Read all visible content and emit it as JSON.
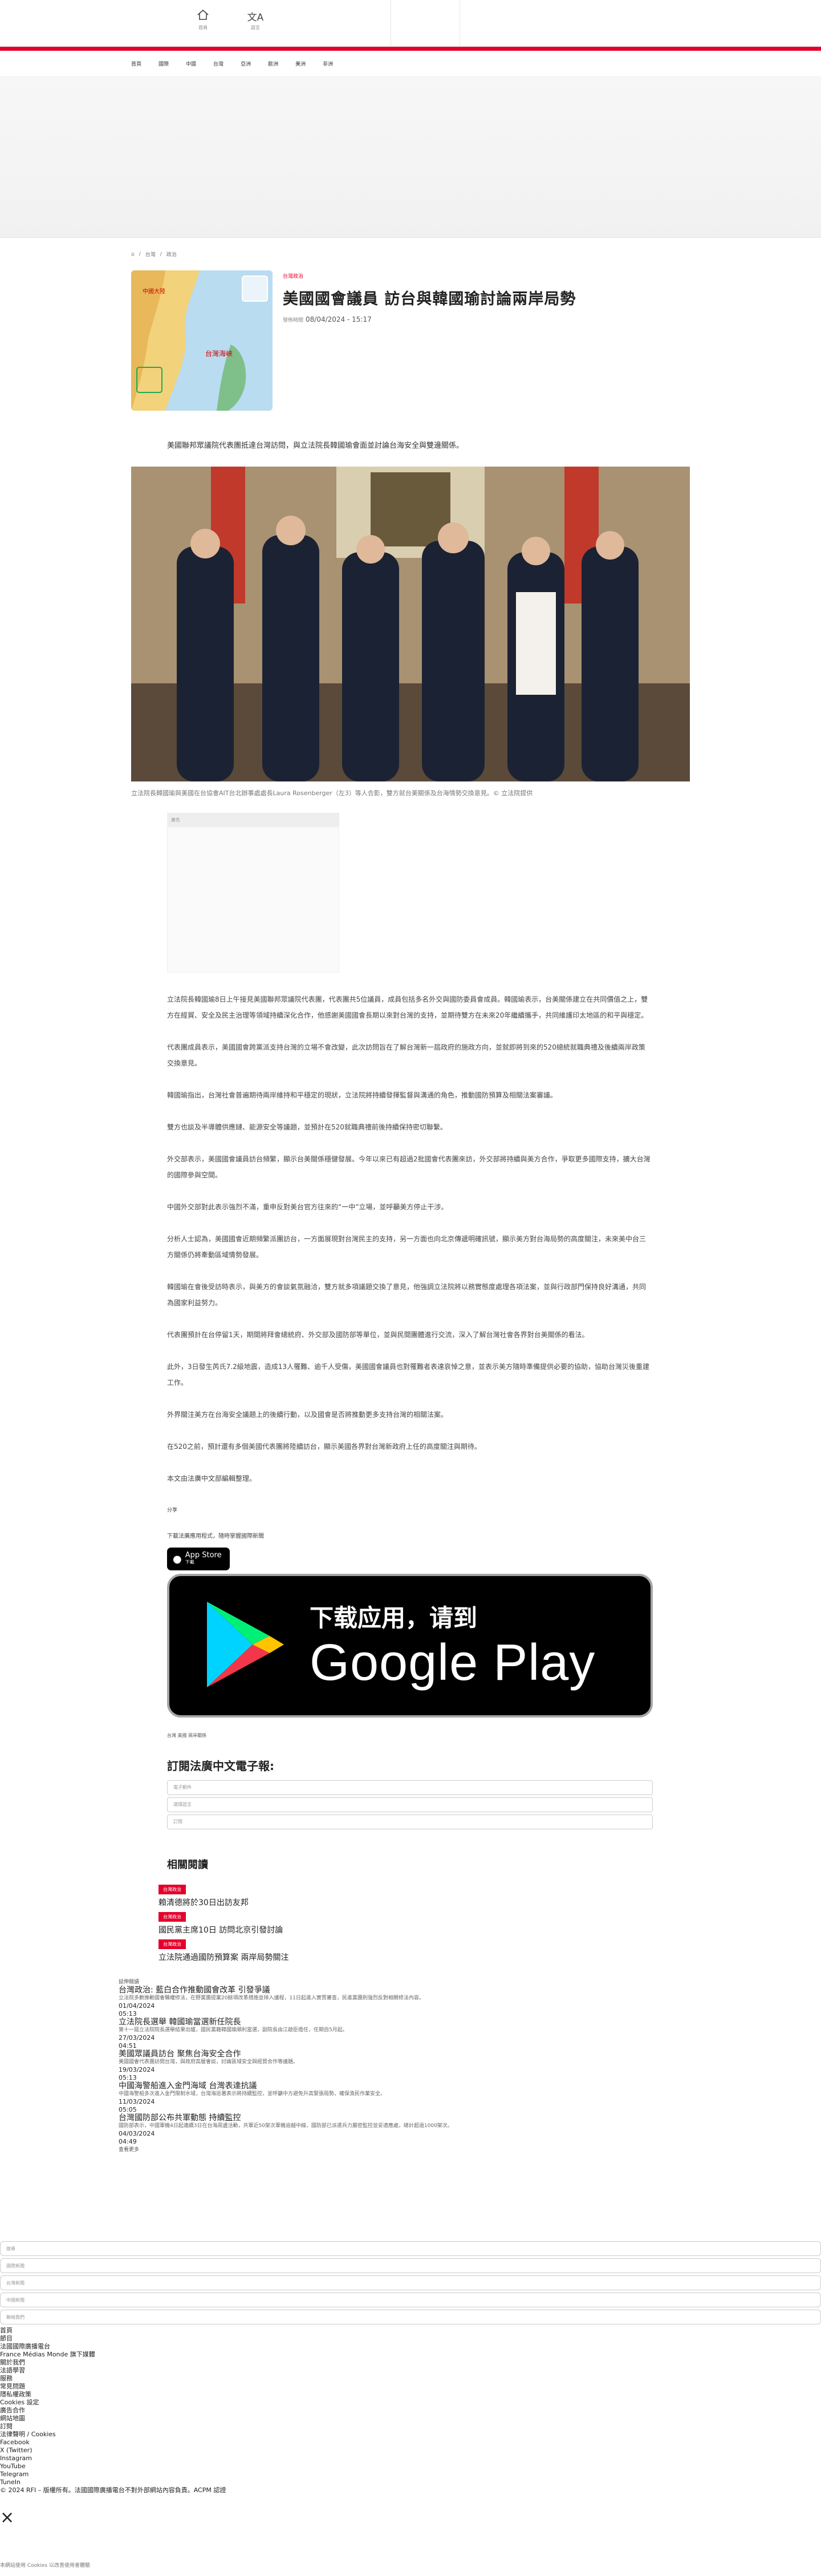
{
  "header": {
    "home_icon": "home-icon",
    "home_label": "首頁",
    "lang_icon": "translate-icon",
    "lang_label": "語言",
    "nav": [
      "首頁",
      "國際",
      "中國",
      "台灣",
      "亞洲",
      "歐洲",
      "美洲",
      "非洲"
    ]
  },
  "breadcrumb": {
    "items": [
      "首頁",
      "台灣",
      "政治"
    ]
  },
  "article": {
    "category": "台灣政治",
    "title": "美國國會議員 訪台與韓國瑜討論兩岸局勢",
    "date_label": "發佈時間",
    "date": "08/04/2024 - 15:17",
    "lead": "美國聯邦眾議院代表團抵達台灣訪問，與立法院長韓國瑜會面並討論台海安全與雙邊關係。",
    "caption": "立法院長韓國瑜與美國在台協會AIT台北辦事處處長Laura Rosenberger（左3）等人合影，雙方就台美關係及台海情勢交換意見。© 立法院提供"
  },
  "ad": {
    "label": "廣告"
  },
  "body": [
    "立法院長韓國瑜8日上午接見美國聯邦眾議院代表團，代表團共5位議員，成員包括多名外交與國防委員會成員。韓國瑜表示，台美關係建立在共同價值之上，雙方在經貿、安全及民主治理等領域持續深化合作，他感謝美國國會長期以來對台灣的支持，並期待雙方在未來20年繼續攜手，共同維護印太地區的和平與穩定。",
    "代表團成員表示，美國國會跨黨派支持台灣的立場不會改變，此次訪問旨在了解台灣新一屆政府的施政方向，並就即將到來的520總統就職典禮及後續兩岸政策交換意見。",
    "韓國瑜指出，台灣社會普遍期待兩岸維持和平穩定的現狀，立法院將持續發揮監督與溝通的角色，推動國防預算及相關法案審議。",
    "雙方也談及半導體供應鏈、能源安全等議題，並預計在520就職典禮前後持續保持密切聯繫。",
    "外交部表示，美國國會議員訪台頻繁，顯示台美關係穩健發展。今年以來已有超過2批國會代表團來訪，外交部將持續與美方合作，爭取更多國際支持，擴大台灣的國際參與空間。",
    "中國外交部對此表示強烈不滿，重申反對美台官方往來的“一中”立場，並呼籲美方停止干涉。",
    "分析人士認為，美國國會近期頻繁派團訪台，一方面展現對台灣民主的支持，另一方面也向北京傳遞明確訊號，顯示美方對台海局勢的高度關注，未來美中台三方關係仍將牽動區域情勢發展。",
    "韓國瑜在會後受訪時表示，與美方的會談氣氛融洽，雙方就多項議題交換了意見，他強調立法院將以務實態度處理各項法案，並與行政部門保持良好溝通，共同為國家利益努力。",
    "代表團預計在台停留1天，期間將拜會總統府、外交部及國防部等單位，並與民間團體進行交流，深入了解台灣社會各界對台美關係的看法。",
    "此外，3日發生芮氏7.2級地震，造成13人罹難、逾千人受傷，美國國會議員也對罹難者表達哀悼之意，並表示美方隨時準備提供必要的協助，協助台灣災後重建工作。",
    "外界關注美方在台海安全議題上的後續行動，以及國會是否將推動更多支持台灣的相關法案。",
    "在520之前，預計還有多個美國代表團將陸續訪台，顯示美國各界對台灣新政府上任的高度關注與期待。",
    "本文由法廣中文部編輯整理。"
  ],
  "share": {
    "label": "分享"
  },
  "app": {
    "promo": "下載法廣應用程式，隨時掌握國際新聞",
    "appstore_small": "下載",
    "appstore_big": "App Store",
    "gplay_line1": "下载应用，请到",
    "gplay_line2": "Google Play",
    "tags": "台灣 美國 兩岸關係"
  },
  "newsletter": {
    "title": "訂閱法廣中文電子報:",
    "fields": [
      "電子郵件",
      "選擇語言",
      "訂閱"
    ]
  },
  "related": {
    "title": "相關閱讀",
    "items": [
      {
        "tag": "台灣政治",
        "title": "賴清德將於30日出訪友邦"
      },
      {
        "tag": "台灣政治",
        "title": "國民黨主席10日 訪問北京引發討論"
      },
      {
        "tag": "台灣政治",
        "title": "立法院通過國防預算案 兩岸局勢關注"
      }
    ]
  },
  "more": {
    "heading": "延伸閱讀",
    "items": [
      {
        "title": "台灣政治: 藍白合作推動國會改革 引發爭議",
        "summary": "立法院多數推動國會職權修法，在野黨團提案20餘項改革措施並排入議程，11日起進入實質審查，民進黨團則強烈反對相關修法內容。",
        "date": "01/04/2024",
        "time": "05:13"
      },
      {
        "title": "立法院長選舉 韓國瑜當選新任院長",
        "summary": "第十一屆立法院院長選舉結果出爐，國民黨籍韓國瑜順利當選，副院長由江啟臣擔任，任期自5月起。",
        "date": "27/03/2024",
        "time": "04:51"
      },
      {
        "title": "美國眾議員訪台 聚焦台海安全合作",
        "summary": "美國國會代表團訪問台灣，與政府高層會談，討論區域安全與經貿合作等議題。",
        "date": "19/03/2024",
        "time": "05:13"
      },
      {
        "title": "中國海警船進入金門海域 台灣表達抗議",
        "summary": "中國海警船多次進入金門限制水域，台灣海巡署表示將持續監控，並呼籲中方避免升高緊張局勢，確保漁民作業安全。",
        "date": "11/03/2024",
        "time": "05:05"
      },
      {
        "title": "台灣國防部公布共軍動態 持續監控",
        "summary": "國防部表示，中國軍機4日起連續3日在台海周邊活動，共軍近50架次軍機逾越中線，國防部已派遣兵力嚴密監控並妥適應處，總計超過1000架次。",
        "date": "04/03/2024",
        "time": "04:49"
      }
    ],
    "more_link": "查看更多"
  },
  "footer": {
    "rows": [
      "搜尋",
      "國際新聞",
      "台灣新聞",
      "中國新聞",
      "聯絡我們"
    ],
    "lines": [
      "首頁",
      "節目",
      "法國國際廣播電台",
      "France Médias Monde 旗下媒體",
      "關於我們",
      "法語學習",
      "服務",
      "常見問題",
      "隱私權政策",
      "Cookies 設定",
      "廣告合作",
      "網站地圖",
      "訂閱",
      "法律聲明 / Cookies",
      "Facebook",
      "X (Twitter)",
      "Instagram",
      "YouTube",
      "Telegram",
      "TuneIn",
      "© 2024 RFI – 版權所有。法國國際廣播電台不對外部網站內容負責。ACPM 認證"
    ],
    "close": "×",
    "cookie": "本網站使用 Cookies 以改善使用者體驗"
  }
}
